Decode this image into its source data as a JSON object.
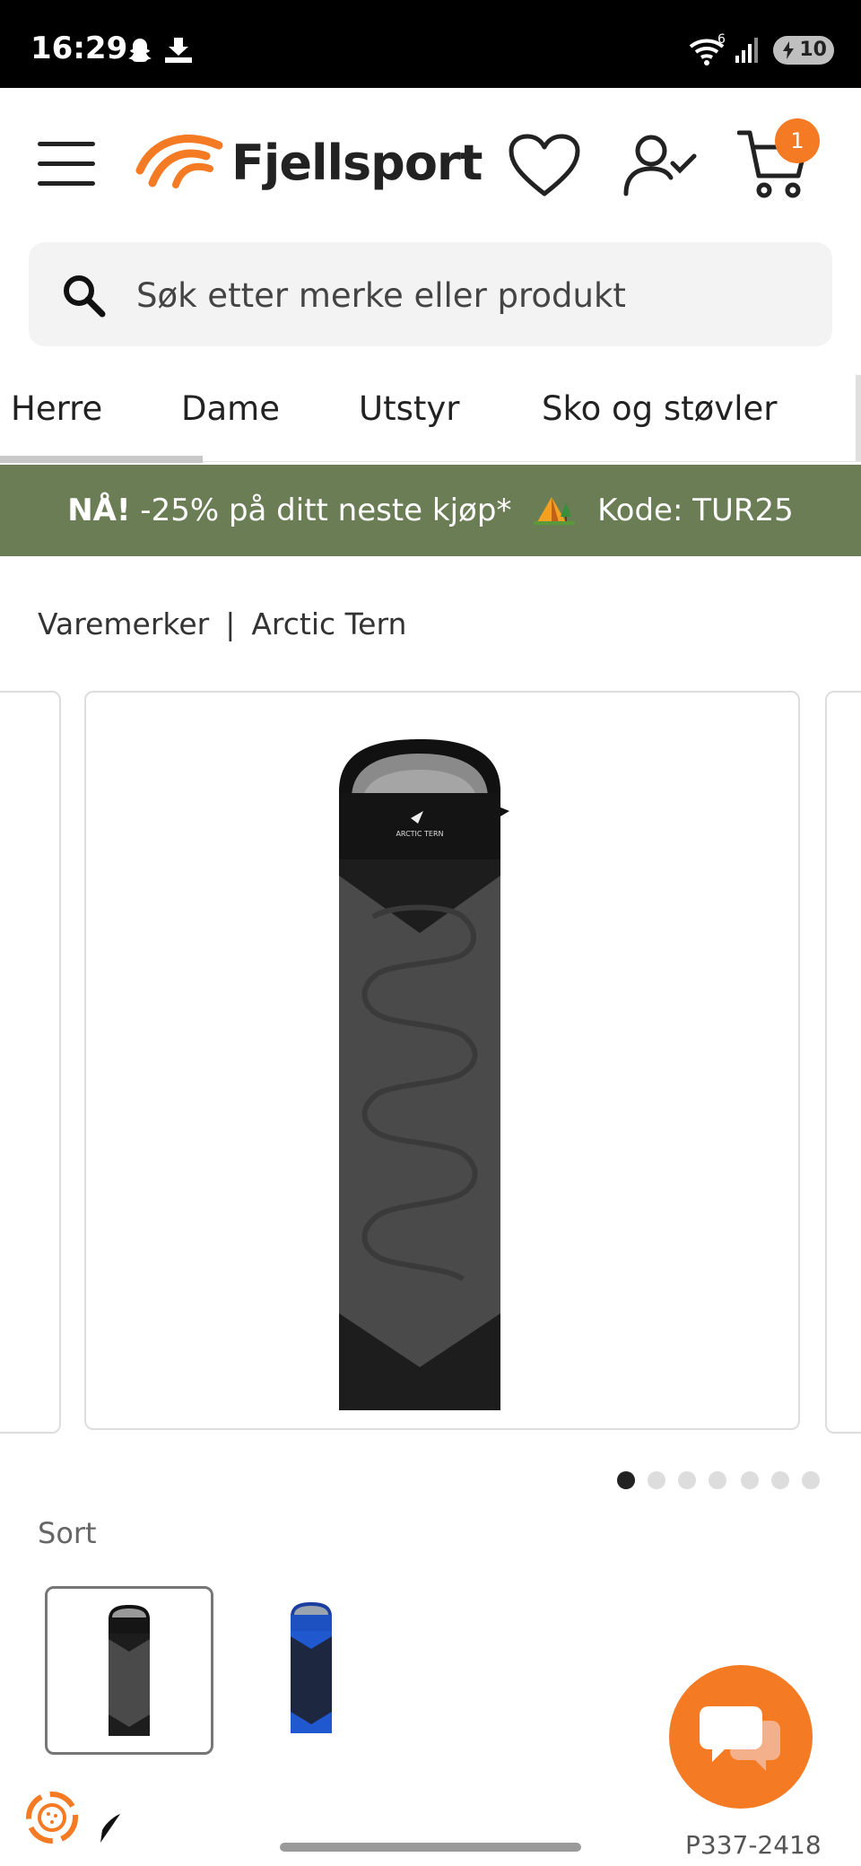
{
  "status_bar": {
    "time": "16:29",
    "battery": "10",
    "wifi_badge": "6"
  },
  "header": {
    "logo_text": "Fjellsport",
    "cart_count": "1"
  },
  "search": {
    "placeholder": "Søk etter merke eller produkt"
  },
  "tabs": [
    {
      "label": "Herre"
    },
    {
      "label": "Dame"
    },
    {
      "label": "Utstyr"
    },
    {
      "label": "Sko og støvler"
    }
  ],
  "promo": {
    "strong": "NÅ!",
    "text": "-25% på ditt neste kjøp*",
    "code": "Kode: TUR25"
  },
  "breadcrumb": {
    "parent": "Varemerker",
    "separator": "|",
    "current": "Arctic Tern"
  },
  "product": {
    "brand_mark": "ARCTIC TERN",
    "active_image_index": 1,
    "image_count": 7
  },
  "color": {
    "label": "Sort",
    "options": [
      "black",
      "blue"
    ]
  },
  "footer": {
    "sku": "P337-2418"
  },
  "colors": {
    "accent": "#f47a24",
    "promo_bg": "#6b7d55",
    "dark": "#222222"
  }
}
